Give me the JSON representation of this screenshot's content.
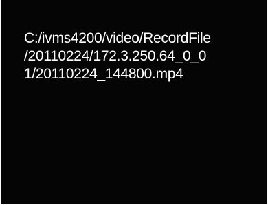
{
  "player": {
    "file_path_lines": [
      "C:/ivms4200/video/RecordFile",
      "/20110224/172.3.250.64_0_0",
      "1/20110224_144800.mp4"
    ]
  },
  "colors": {
    "panel_background": "#050505",
    "text": "#ffffff",
    "page_background": "#fbfbfb",
    "panel_border": "#9a9a9a"
  }
}
